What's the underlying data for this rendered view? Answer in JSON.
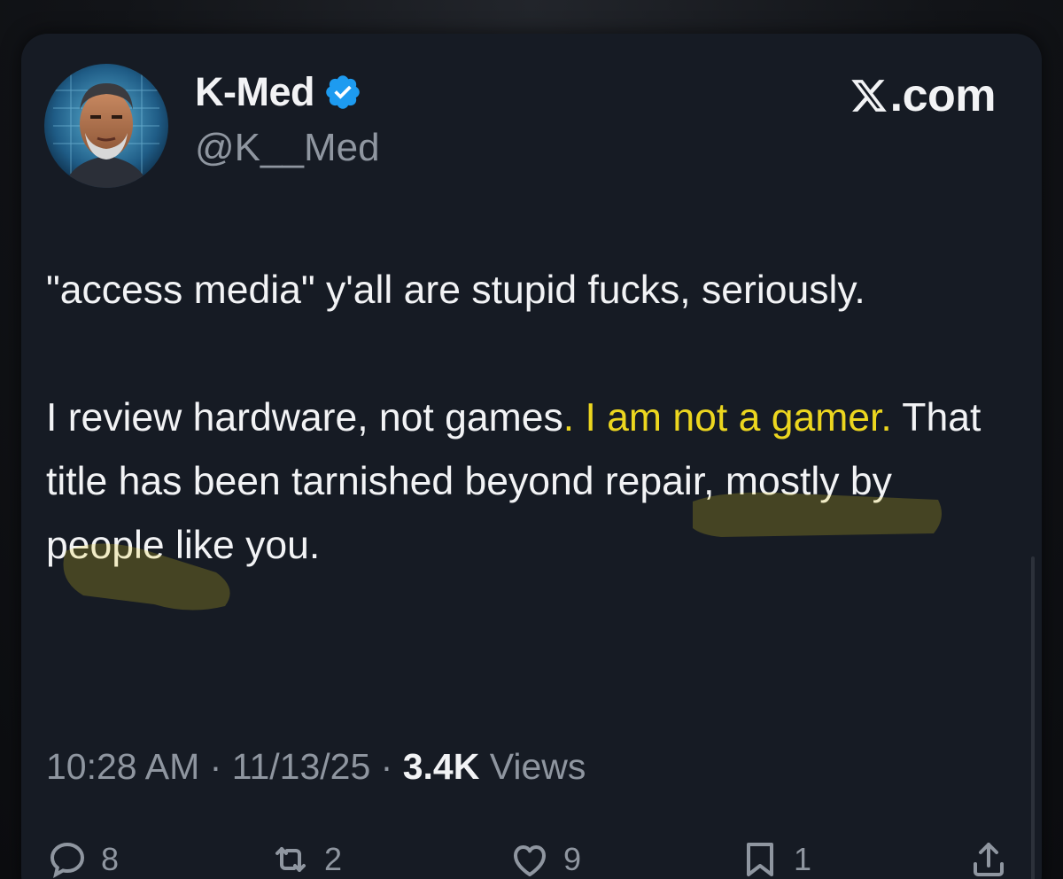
{
  "author": {
    "display_name": "K-Med",
    "handle": "@K__Med",
    "verified": true,
    "avatar_icon": "portrait-avatar"
  },
  "brand": {
    "logo_icon": "x-logo-icon",
    "text": ".com"
  },
  "post": {
    "paragraph1": "\"access media\" y'all are stupid fucks, seriously.",
    "paragraph2_before": "I review hardware, not games",
    "paragraph2_highlight": ". I am not a gamer.",
    "paragraph2_after": " That title has been tarnished beyond repair, mostly by people like you.",
    "highlight_color": "#ecd61f"
  },
  "meta": {
    "time": "10:28 AM",
    "separator": "·",
    "date": "11/13/25",
    "views_count": "3.4K",
    "views_label": "Views"
  },
  "actions": {
    "replies": "8",
    "reposts": "2",
    "likes": "9",
    "bookmarks": "1"
  },
  "colors": {
    "background": "#161b24",
    "text": "#f2f3f5",
    "muted": "#8f96a0",
    "verified": "#1d9bf0"
  }
}
